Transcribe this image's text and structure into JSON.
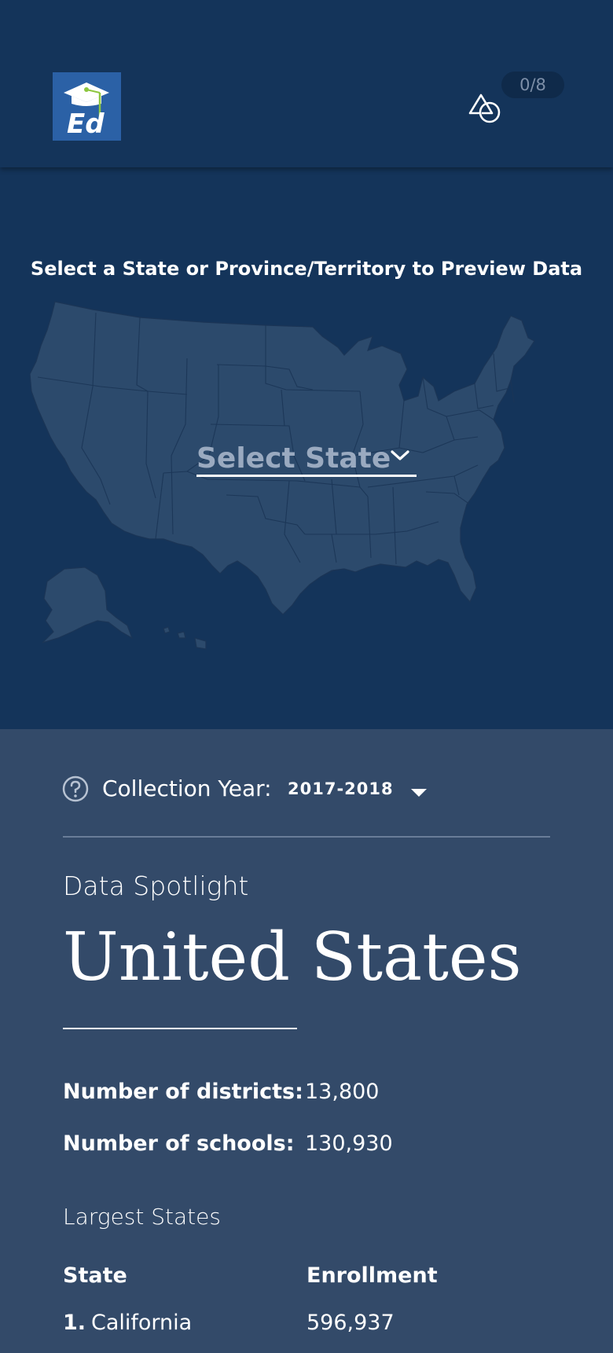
{
  "header": {
    "logo_text": "Ed",
    "logo_icon": "graduation-cap-icon",
    "shapes_icon": "shapes-icon",
    "counter": "0/8"
  },
  "map": {
    "title": "Select a State or Province/Territory to Preview Data",
    "select_label": "Select State",
    "select_icon": "chevron-down-icon"
  },
  "filters": {
    "help_icon": "help-circle-icon",
    "collection_year_label": "Collection Year:",
    "collection_year_value": "2017-2018",
    "dropdown_icon": "caret-down-icon"
  },
  "spotlight": {
    "label": "Data Spotlight",
    "country": "United States",
    "stats": [
      {
        "label": "Number of districts:",
        "value": "13,800"
      },
      {
        "label": "Number of schools:",
        "value": "130,930"
      }
    ],
    "largest_title": "Largest States",
    "table": {
      "headers": [
        "State",
        "Enrollment"
      ],
      "rows": [
        {
          "rank": "1.",
          "state": "California",
          "enrollment": "596,937"
        }
      ]
    }
  },
  "colors": {
    "header_bg": "#14345a",
    "map_fill": "#2c4a6c",
    "panel_bg": "#334a69",
    "logo_bg": "#2b61a6",
    "accent_green": "#8dc63f"
  }
}
